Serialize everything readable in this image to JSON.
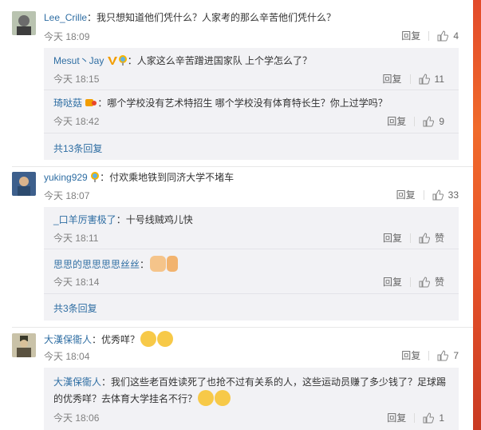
{
  "comments": [
    {
      "user": "Lee_Crille",
      "text": "：我只想知道他们凭什么？人家考的那么辛苦他们凭什么？",
      "time": "今天 18:09",
      "reply": "回复",
      "likes": "4",
      "subs": [
        {
          "user": "Mesut丶Jay",
          "text": "：人家这么辛苦蹭进国家队 上个学怎么了？",
          "time": "今天 18:15",
          "reply": "回复",
          "likes": "11"
        },
        {
          "user": "琦哒菇",
          "text": "：哪个学校没有艺术特招生 哪个学校没有体育特长生？你上过学吗？",
          "time": "今天 18:42",
          "reply": "回复",
          "likes": "9"
        }
      ],
      "more": "共13条回复"
    },
    {
      "user": "yuking929",
      "text": "：付欢乘地铁到同济大学不堵车",
      "time": "今天 18:07",
      "reply": "回复",
      "likes": "33",
      "subs": [
        {
          "user": "_口羊厉害极了",
          "text": "：十号线贼鸡儿快",
          "time": "今天 18:11",
          "reply": "回复",
          "likes": "赞"
        },
        {
          "user": "思思的思思思思丝丝",
          "text": "：",
          "time": "今天 18:14",
          "reply": "回复",
          "likes": "赞"
        }
      ],
      "more": "共3条回复"
    },
    {
      "user": "大漢保衞人",
      "text": "：优秀咩？",
      "time": "今天 18:04",
      "reply": "回复",
      "likes": "7",
      "subs": [
        {
          "user": "大漢保衞人",
          "text": "：我们这些老百姓读死了也抢不过有关系的人，这些运动员赚了多少钱了？足球踢",
          "text2": "的优秀咩？去体育大学挂名不行？",
          "time": "今天 18:06",
          "reply": "回复",
          "likes": "1"
        }
      ]
    }
  ],
  "colors": {
    "username": "#2f6ea3",
    "subbox": "#f2f2f5",
    "muted": "#808080"
  }
}
